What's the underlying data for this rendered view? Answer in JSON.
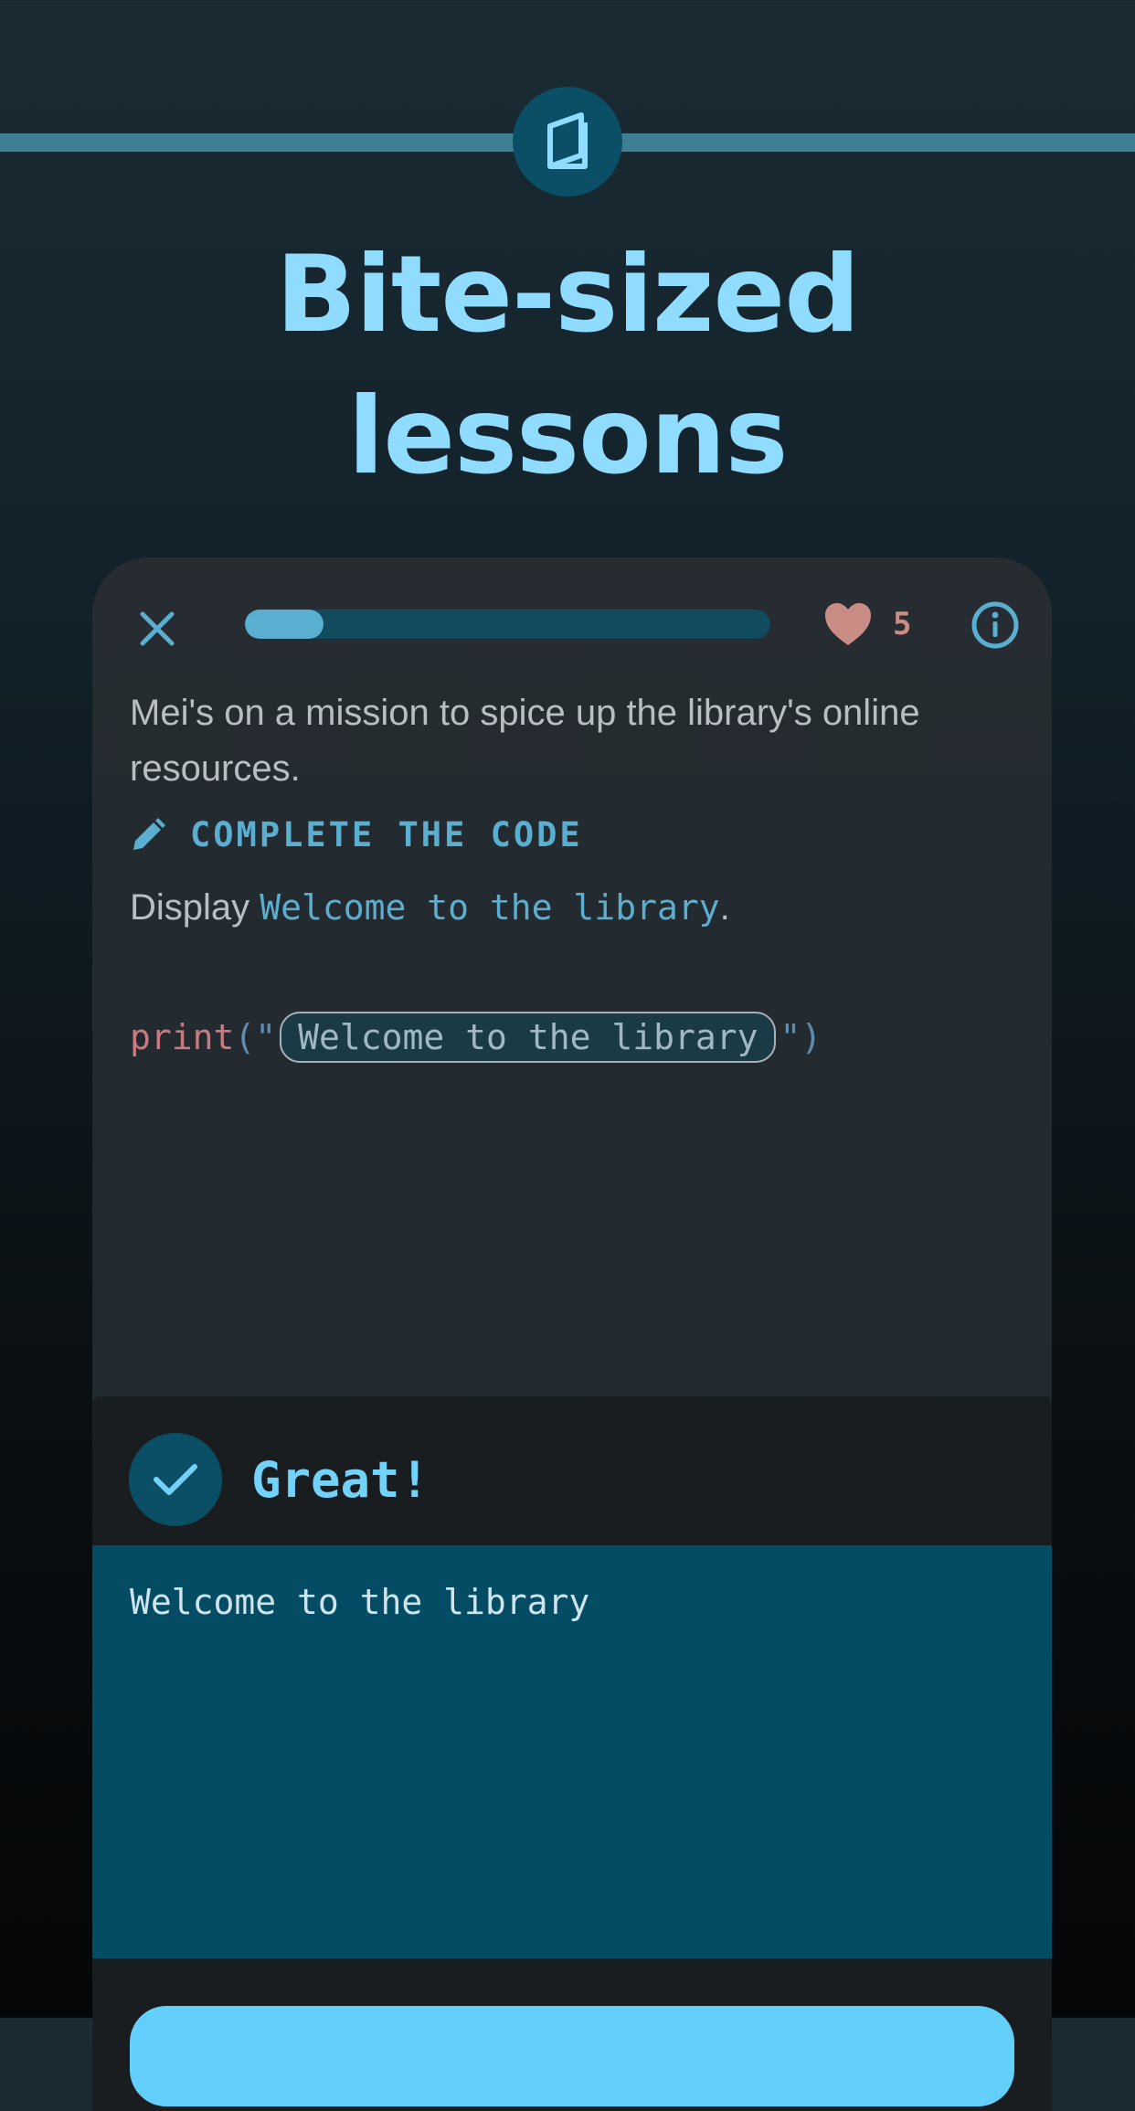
{
  "header": {
    "icon": "book-icon",
    "title_line1": "Bite-sized",
    "title_line2": "lessons"
  },
  "lesson": {
    "close_icon": "close-icon",
    "progress_fraction": 0.15,
    "hearts_icon": "heart-icon",
    "hearts": "5",
    "info_icon": "info-icon",
    "story": "Mei's on a mission to spice up the library's online resources.",
    "task_icon": "pencil-icon",
    "task_label": "COMPLETE THE CODE",
    "instruction_prefix": "Display ",
    "instruction_code": "Welcome to the library",
    "instruction_suffix": ".",
    "code": {
      "function": "print",
      "open": "(\"",
      "answer": "Welcome to the library",
      "close": "\")"
    }
  },
  "feedback": {
    "icon": "check-icon",
    "title": "Great!",
    "output": "Welcome to the library"
  },
  "colors": {
    "accent": "#62d0fb",
    "title": "#8fdcff",
    "heart": "#c98d86",
    "output_bg": "#034c63"
  }
}
